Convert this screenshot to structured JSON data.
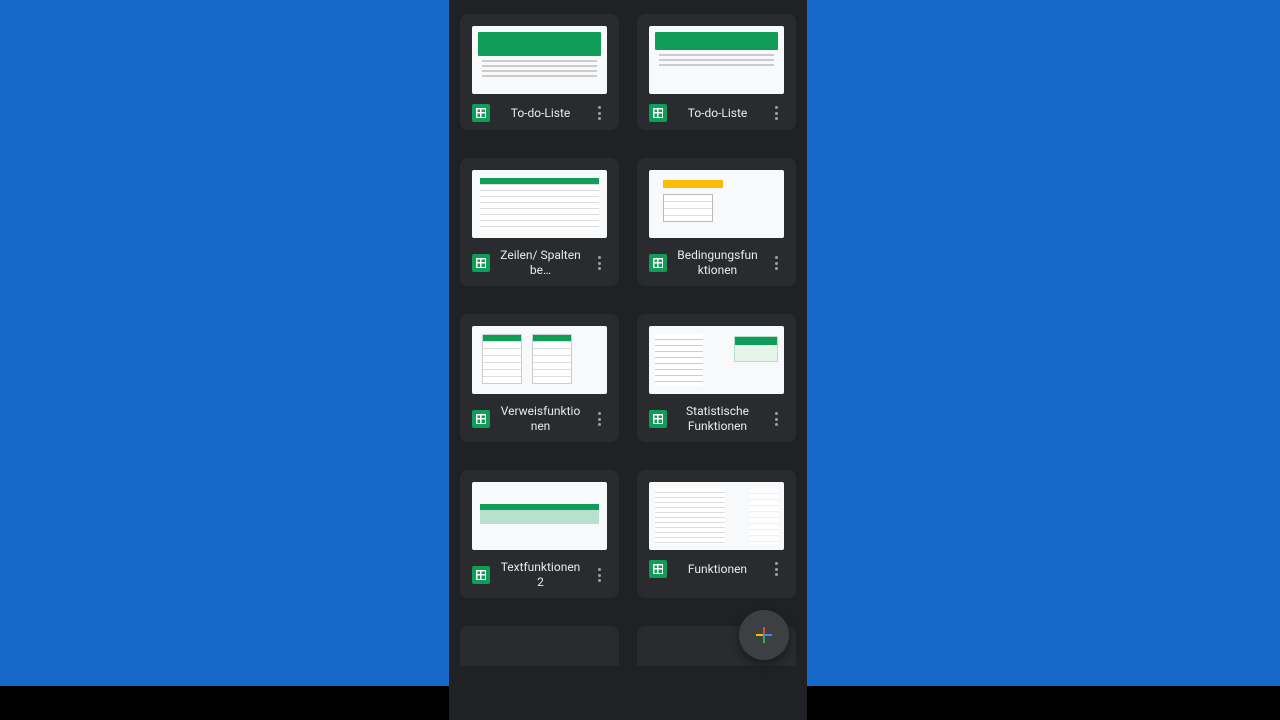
{
  "colors": {
    "sheets_green": "#0f9d58",
    "surface": "#2a2b2e",
    "bg": "#202124"
  },
  "files": [
    {
      "id": 0,
      "title": "To-do-Liste",
      "thumb": "todo"
    },
    {
      "id": 1,
      "title": "To-do-Liste",
      "thumb": "todo2"
    },
    {
      "id": 2,
      "title": "Zeilen/ Spalten be…",
      "thumb": "grid"
    },
    {
      "id": 3,
      "title": "Bedingungsfunktionen",
      "thumb": "cond"
    },
    {
      "id": 4,
      "title": "Verweisfunktionen",
      "thumb": "ref"
    },
    {
      "id": 5,
      "title": "Statistische Funktionen",
      "thumb": "stat"
    },
    {
      "id": 6,
      "title": "Textfunktionen 2",
      "thumb": "text2"
    },
    {
      "id": 7,
      "title": "Funktionen",
      "thumb": "func"
    }
  ],
  "fab": {
    "aria": "Neu erstellen"
  }
}
